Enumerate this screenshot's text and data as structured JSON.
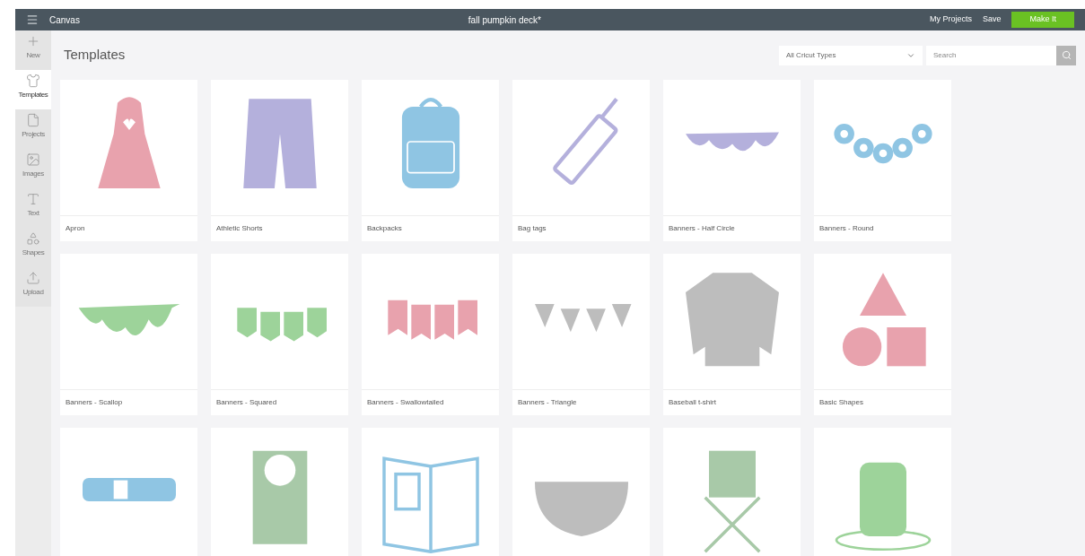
{
  "topbar": {
    "menu_label": "Canvas",
    "title": "fall pumpkin deck*",
    "links": [
      "My Projects",
      "Save"
    ],
    "primary_button": "Make It"
  },
  "sidebar": {
    "items": [
      {
        "label": "New",
        "kind": "plus",
        "selected": false
      },
      {
        "label": "Templates",
        "kind": "shirt",
        "selected": true
      },
      {
        "label": "Projects",
        "kind": "file",
        "selected": false
      },
      {
        "label": "Images",
        "kind": "image",
        "selected": false
      },
      {
        "label": "Text",
        "kind": "text",
        "selected": false
      },
      {
        "label": "Shapes",
        "kind": "shapes",
        "selected": false
      },
      {
        "label": "Upload",
        "kind": "upload",
        "selected": false
      }
    ]
  },
  "header": {
    "title": "Templates",
    "filter": "All Cricut Types",
    "search": {
      "placeholder": "Search"
    }
  },
  "templates": [
    {
      "kind": "apron",
      "label": "Apron"
    },
    {
      "kind": "shorts",
      "label": "Athletic Shorts"
    },
    {
      "kind": "backpack",
      "label": "Backpacks"
    },
    {
      "kind": "tag",
      "label": "Bag tags"
    },
    {
      "kind": "halfcircle",
      "label": "Banners - Half Circle"
    },
    {
      "kind": "round",
      "label": "Banners - Round"
    },
    {
      "kind": "scallop",
      "label": "Banners - Scallop"
    },
    {
      "kind": "squared",
      "label": "Banners - Squared"
    },
    {
      "kind": "swallowtail",
      "label": "Banners - Swallowtailed"
    },
    {
      "kind": "triangle",
      "label": "Banners - Triangle"
    },
    {
      "kind": "tshirt",
      "label": "Baseball t-shirt"
    },
    {
      "kind": "shapes",
      "label": "Basic Shapes"
    },
    {
      "kind": "belt"
    },
    {
      "kind": "bib"
    },
    {
      "kind": "book"
    },
    {
      "kind": "bowl"
    },
    {
      "kind": "chair"
    },
    {
      "kind": "candle"
    }
  ]
}
